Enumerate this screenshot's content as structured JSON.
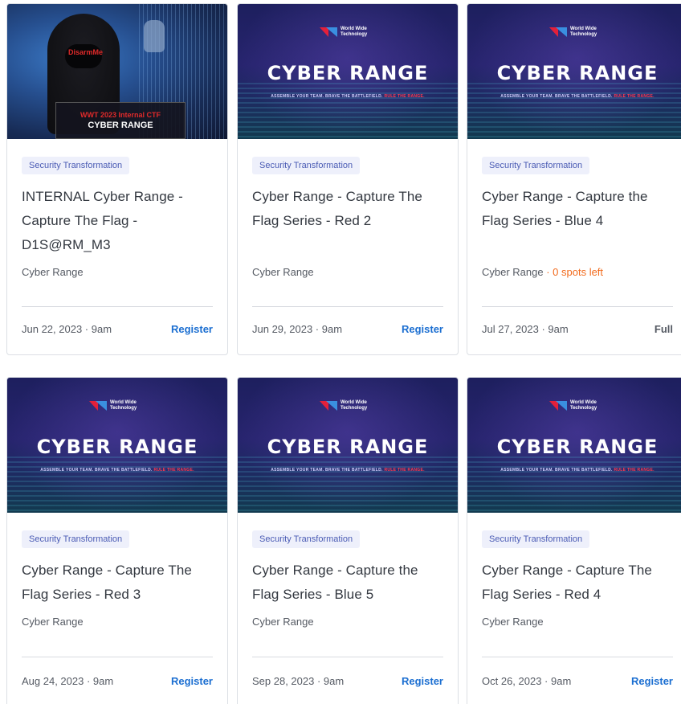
{
  "banner": {
    "brand_text": "World Wide Technology",
    "title": "CYBER RANGE",
    "tagline_main": "ASSEMBLE YOUR TEAM. BRAVE THE BATTLEFIELD.",
    "tagline_accent": "RULE THE RANGE.",
    "hacker_name": "DisarmMe",
    "ctf_line1": "WWT 2023 Internal CTF",
    "ctf_line2": "CYBER RANGE"
  },
  "colors": {
    "badge_bg": "#eef0fb",
    "badge_text": "#4a5bb4",
    "register": "#1c6fd1",
    "spots_warning": "#f26b1d"
  },
  "cards": [
    {
      "badge": "Security Transformation",
      "title": "INTERNAL Cyber Range - Capture The Flag - D1S@RM_M3",
      "category": "Cyber Range",
      "spots": "",
      "date": "Jun 22, 2023 · 9am",
      "action": "Register"
    },
    {
      "badge": "Security Transformation",
      "title": "Cyber Range - Capture The Flag Series - Red 2",
      "category": "Cyber Range",
      "spots": "",
      "date": "Jun 29, 2023 · 9am",
      "action": "Register"
    },
    {
      "badge": "Security Transformation",
      "title": "Cyber Range - Capture the Flag Series - Blue 4",
      "category": "Cyber Range",
      "spots": " · 0 spots left",
      "date": "Jul 27, 2023 · 9am",
      "action": "Full"
    },
    {
      "badge": "Security Transformation",
      "title": "Cyber Range - Capture The Flag Series - Red 3",
      "category": "Cyber Range",
      "spots": "",
      "date": "Aug 24, 2023 · 9am",
      "action": "Register"
    },
    {
      "badge": "Security Transformation",
      "title": "Cyber Range - Capture the Flag Series - Blue 5",
      "category": "Cyber Range",
      "spots": "",
      "date": "Sep 28, 2023 · 9am",
      "action": "Register"
    },
    {
      "badge": "Security Transformation",
      "title": "Cyber Range - Capture The Flag Series - Red 4",
      "category": "Cyber Range",
      "spots": "",
      "date": "Oct 26, 2023 · 9am",
      "action": "Register"
    }
  ]
}
